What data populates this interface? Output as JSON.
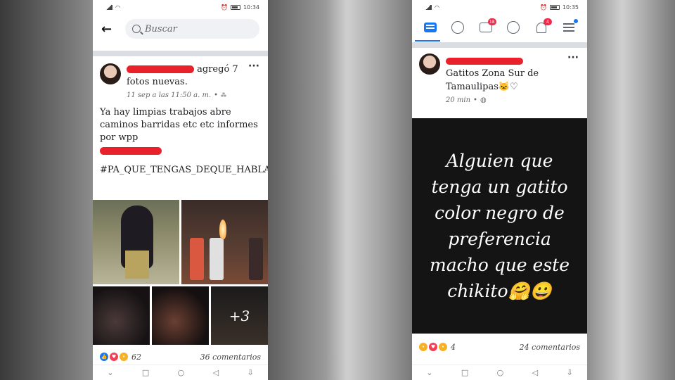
{
  "left_phone": {
    "status": {
      "time": "10:34"
    },
    "search": {
      "placeholder": "Buscar"
    },
    "post": {
      "author_suffix": "agregó 7 fotos nuevas.",
      "timestamp": "11 sep a las 11:50 a. m.",
      "text": "Ya hay limpias trabajos  abre caminos barridas etc  etc informes por wpp",
      "hashtag": "#PA_QUE_TENGAS_DEQUE_HABLAR",
      "more_photos": "+3",
      "reaction_count": "62",
      "comments": "36 comentarios"
    }
  },
  "right_phone": {
    "status": {
      "time": "10:35"
    },
    "tabs": {
      "video_badge": "18",
      "notif_badge": "4"
    },
    "post": {
      "group": "Gatitos Zona Sur de Tamaulipas🐱♡",
      "timestamp": "20 min",
      "card_text": "Alguien que tenga un gatito color negro de preferencia macho que este chikito🤗😀",
      "reaction_count": "4",
      "comments": "24 comentarios"
    }
  },
  "colors": {
    "brand": "#1877f2",
    "redaction": "#e8212a",
    "badge": "#f02849"
  }
}
